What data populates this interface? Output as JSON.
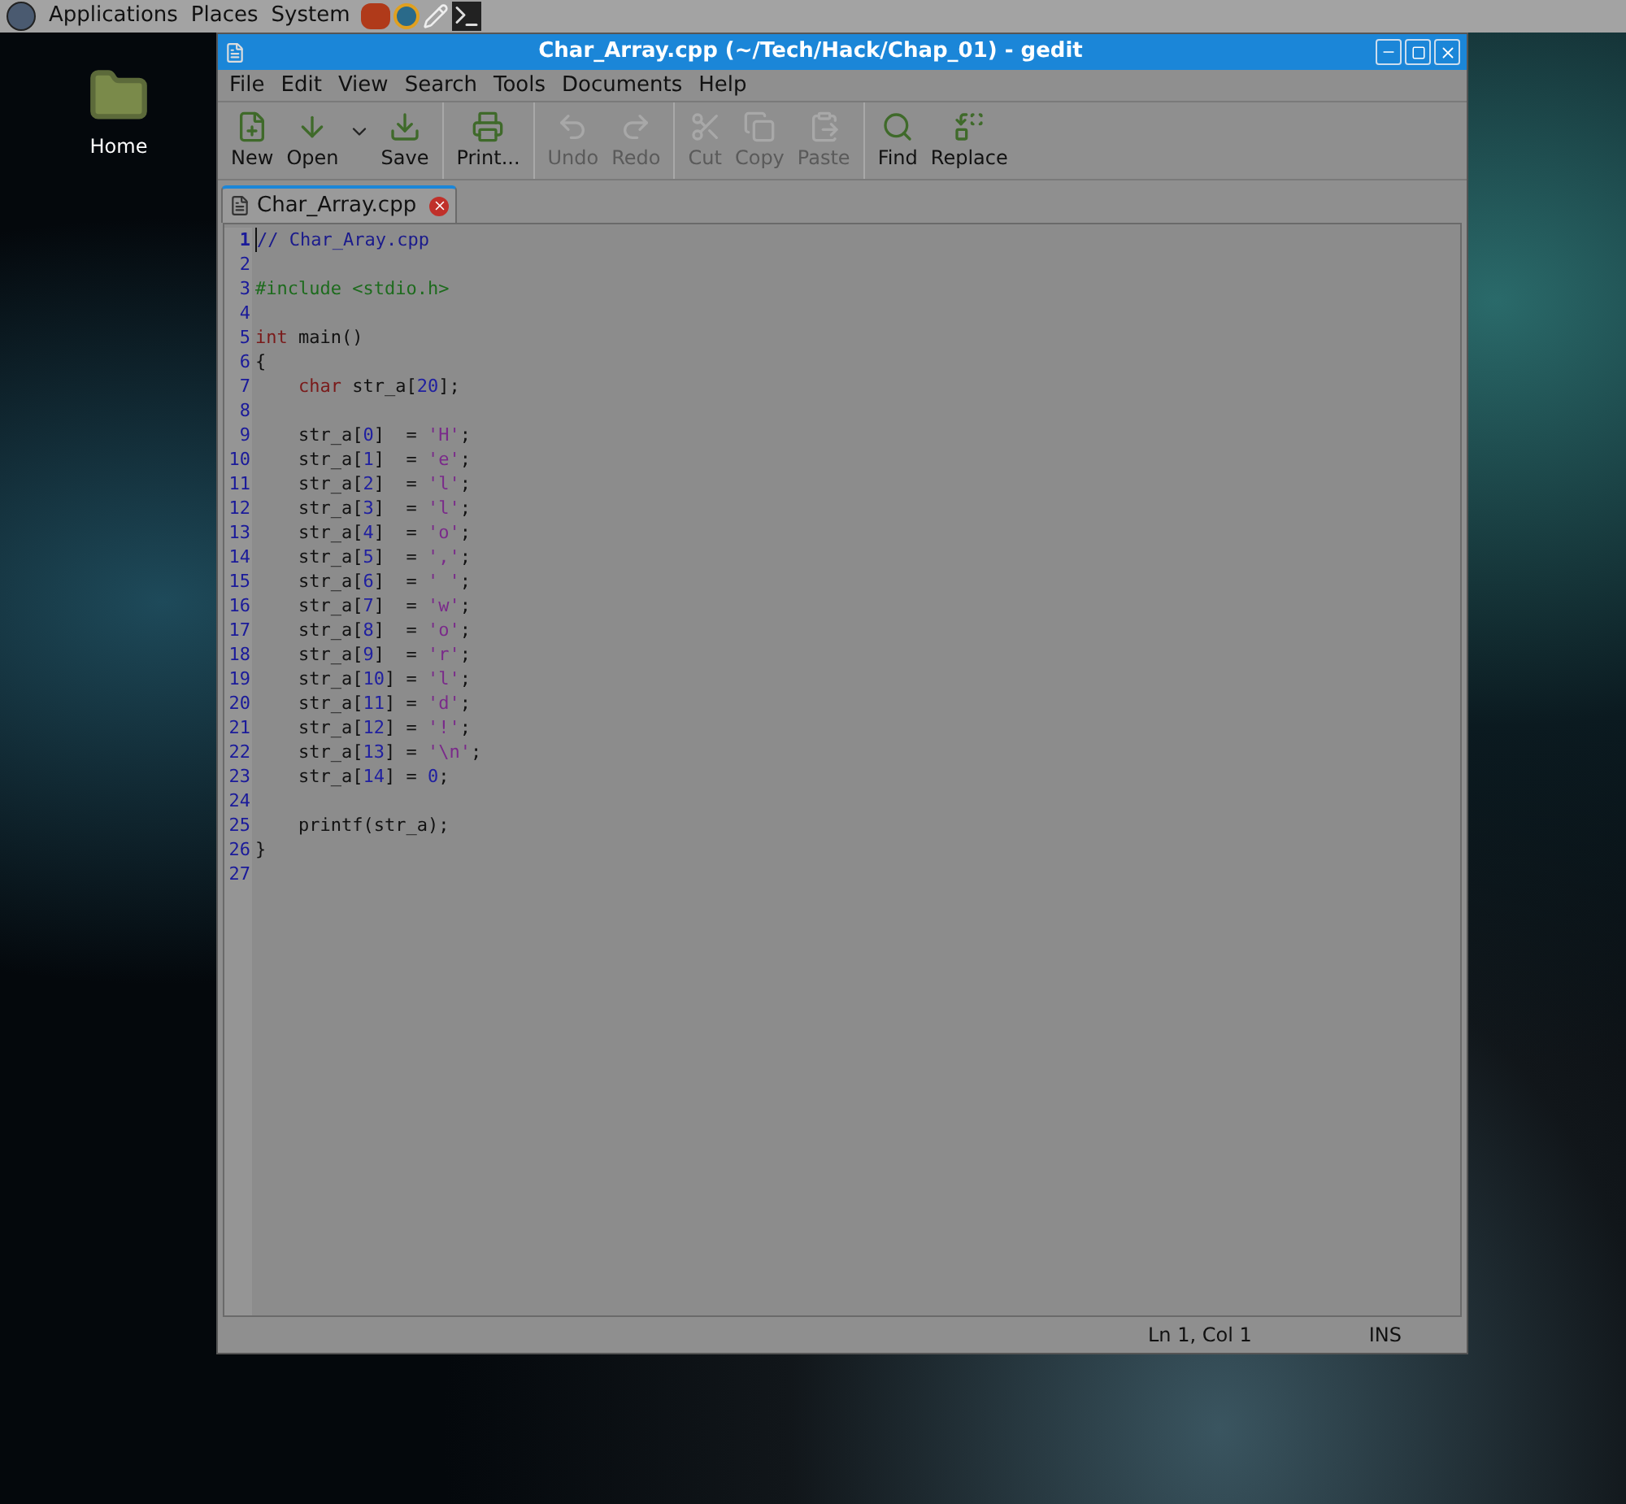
{
  "top_panel": {
    "menus": [
      "Applications",
      "Places",
      "System"
    ]
  },
  "desktop": {
    "icons": [
      {
        "label": "Home"
      }
    ]
  },
  "window": {
    "title": "Char_Array.cpp (~/Tech/Hack/Chap_01) - gedit"
  },
  "menubar": [
    "File",
    "Edit",
    "View",
    "Search",
    "Tools",
    "Documents",
    "Help"
  ],
  "toolbar": {
    "groups": [
      [
        {
          "label": "New",
          "disabled": false,
          "has_menu": false
        },
        {
          "label": "Open",
          "disabled": false,
          "has_menu": true
        },
        {
          "label": "Save",
          "disabled": false,
          "has_menu": false
        }
      ],
      [
        {
          "label": "Print...",
          "disabled": false,
          "has_menu": false
        }
      ],
      [
        {
          "label": "Undo",
          "disabled": true,
          "has_menu": false
        },
        {
          "label": "Redo",
          "disabled": true,
          "has_menu": false
        }
      ],
      [
        {
          "label": "Cut",
          "disabled": true,
          "has_menu": false
        },
        {
          "label": "Copy",
          "disabled": true,
          "has_menu": false
        },
        {
          "label": "Paste",
          "disabled": true,
          "has_menu": false
        }
      ],
      [
        {
          "label": "Find",
          "disabled": false,
          "has_menu": false
        },
        {
          "label": "Replace",
          "disabled": false,
          "has_menu": false
        }
      ]
    ]
  },
  "tabs": [
    {
      "label": "Char_Array.cpp",
      "selected": true
    }
  ],
  "editor": {
    "lines": [
      {
        "number": "1",
        "current": true,
        "tokens": [
          {
            "kind": "comment",
            "text": "// Char_Aray.cpp"
          }
        ]
      },
      {
        "number": "2",
        "current": false
      },
      {
        "number": "3",
        "current": false,
        "tokens": [
          {
            "kind": "preproc",
            "text": "#include <stdio.h>"
          }
        ]
      },
      {
        "number": "4",
        "current": false
      },
      {
        "number": "5",
        "current": false,
        "tokens": [
          {
            "kind": "keyword",
            "text": "int"
          },
          {
            "kind": "plain",
            "text": " main()"
          }
        ]
      },
      {
        "number": "6",
        "current": false,
        "tokens": [
          {
            "kind": "plain",
            "text": "{"
          }
        ]
      },
      {
        "number": "7",
        "current": false,
        "tokens": [
          {
            "kind": "keyword",
            "text": "    char"
          },
          {
            "kind": "plain",
            "text": " str_a["
          },
          {
            "kind": "number",
            "text": "20"
          },
          {
            "kind": "plain",
            "text": "];"
          }
        ]
      },
      {
        "number": "8",
        "current": false
      },
      {
        "number": "9",
        "current": false,
        "tokens": [
          {
            "kind": "plain",
            "text": "    str_a["
          },
          {
            "kind": "number",
            "text": "0"
          },
          {
            "kind": "plain",
            "text": "]  = "
          },
          {
            "kind": "string",
            "text": "'H'"
          },
          {
            "kind": "plain",
            "text": ";"
          }
        ]
      },
      {
        "number": "10",
        "current": false,
        "tokens": [
          {
            "kind": "plain",
            "text": "    str_a["
          },
          {
            "kind": "number",
            "text": "1"
          },
          {
            "kind": "plain",
            "text": "]  = "
          },
          {
            "kind": "string",
            "text": "'e'"
          },
          {
            "kind": "plain",
            "text": ";"
          }
        ]
      },
      {
        "number": "11",
        "current": false,
        "tokens": [
          {
            "kind": "plain",
            "text": "    str_a["
          },
          {
            "kind": "number",
            "text": "2"
          },
          {
            "kind": "plain",
            "text": "]  = "
          },
          {
            "kind": "string",
            "text": "'l'"
          },
          {
            "kind": "plain",
            "text": ";"
          }
        ]
      },
      {
        "number": "12",
        "current": false,
        "tokens": [
          {
            "kind": "plain",
            "text": "    str_a["
          },
          {
            "kind": "number",
            "text": "3"
          },
          {
            "kind": "plain",
            "text": "]  = "
          },
          {
            "kind": "string",
            "text": "'l'"
          },
          {
            "kind": "plain",
            "text": ";"
          }
        ]
      },
      {
        "number": "13",
        "current": false,
        "tokens": [
          {
            "kind": "plain",
            "text": "    str_a["
          },
          {
            "kind": "number",
            "text": "4"
          },
          {
            "kind": "plain",
            "text": "]  = "
          },
          {
            "kind": "string",
            "text": "'o'"
          },
          {
            "kind": "plain",
            "text": ";"
          }
        ]
      },
      {
        "number": "14",
        "current": false,
        "tokens": [
          {
            "kind": "plain",
            "text": "    str_a["
          },
          {
            "kind": "number",
            "text": "5"
          },
          {
            "kind": "plain",
            "text": "]  = "
          },
          {
            "kind": "string",
            "text": "','"
          },
          {
            "kind": "plain",
            "text": ";"
          }
        ]
      },
      {
        "number": "15",
        "current": false,
        "tokens": [
          {
            "kind": "plain",
            "text": "    str_a["
          },
          {
            "kind": "number",
            "text": "6"
          },
          {
            "kind": "plain",
            "text": "]  = "
          },
          {
            "kind": "string",
            "text": "' '"
          },
          {
            "kind": "plain",
            "text": ";"
          }
        ]
      },
      {
        "number": "16",
        "current": false,
        "tokens": [
          {
            "kind": "plain",
            "text": "    str_a["
          },
          {
            "kind": "number",
            "text": "7"
          },
          {
            "kind": "plain",
            "text": "]  = "
          },
          {
            "kind": "string",
            "text": "'w'"
          },
          {
            "kind": "plain",
            "text": ";"
          }
        ]
      },
      {
        "number": "17",
        "current": false,
        "tokens": [
          {
            "kind": "plain",
            "text": "    str_a["
          },
          {
            "kind": "number",
            "text": "8"
          },
          {
            "kind": "plain",
            "text": "]  = "
          },
          {
            "kind": "string",
            "text": "'o'"
          },
          {
            "kind": "plain",
            "text": ";"
          }
        ]
      },
      {
        "number": "18",
        "current": false,
        "tokens": [
          {
            "kind": "plain",
            "text": "    str_a["
          },
          {
            "kind": "number",
            "text": "9"
          },
          {
            "kind": "plain",
            "text": "]  = "
          },
          {
            "kind": "string",
            "text": "'r'"
          },
          {
            "kind": "plain",
            "text": ";"
          }
        ]
      },
      {
        "number": "19",
        "current": false,
        "tokens": [
          {
            "kind": "plain",
            "text": "    str_a["
          },
          {
            "kind": "number",
            "text": "10"
          },
          {
            "kind": "plain",
            "text": "] = "
          },
          {
            "kind": "string",
            "text": "'l'"
          },
          {
            "kind": "plain",
            "text": ";"
          }
        ]
      },
      {
        "number": "20",
        "current": false,
        "tokens": [
          {
            "kind": "plain",
            "text": "    str_a["
          },
          {
            "kind": "number",
            "text": "11"
          },
          {
            "kind": "plain",
            "text": "] = "
          },
          {
            "kind": "string",
            "text": "'d'"
          },
          {
            "kind": "plain",
            "text": ";"
          }
        ]
      },
      {
        "number": "21",
        "current": false,
        "tokens": [
          {
            "kind": "plain",
            "text": "    str_a["
          },
          {
            "kind": "number",
            "text": "12"
          },
          {
            "kind": "plain",
            "text": "] = "
          },
          {
            "kind": "string",
            "text": "'!'"
          },
          {
            "kind": "plain",
            "text": ";"
          }
        ]
      },
      {
        "number": "22",
        "current": false,
        "tokens": [
          {
            "kind": "plain",
            "text": "    str_a["
          },
          {
            "kind": "number",
            "text": "13"
          },
          {
            "kind": "plain",
            "text": "] = "
          },
          {
            "kind": "string",
            "text": "'\\n'"
          },
          {
            "kind": "plain",
            "text": ";"
          }
        ]
      },
      {
        "number": "23",
        "current": false,
        "tokens": [
          {
            "kind": "plain",
            "text": "    str_a["
          },
          {
            "kind": "number",
            "text": "14"
          },
          {
            "kind": "plain",
            "text": "] = "
          },
          {
            "kind": "number",
            "text": "0"
          },
          {
            "kind": "plain",
            "text": ";"
          }
        ]
      },
      {
        "number": "24",
        "current": false
      },
      {
        "number": "25",
        "current": false,
        "tokens": [
          {
            "kind": "plain",
            "text": "    printf(str_a);"
          }
        ]
      },
      {
        "number": "26",
        "current": false,
        "tokens": [
          {
            "kind": "plain",
            "text": "}"
          }
        ]
      },
      {
        "number": "27",
        "current": false
      }
    ]
  },
  "status_bar": {
    "position": "Ln 1, Col 1",
    "mode": "INS"
  }
}
